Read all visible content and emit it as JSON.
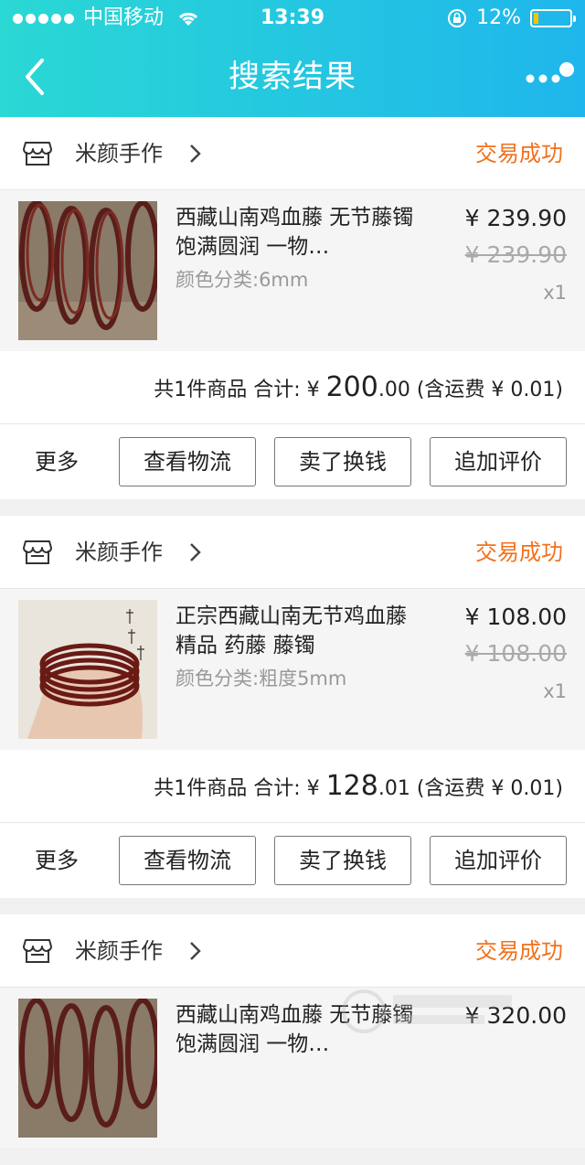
{
  "status_bar": {
    "carrier": "中国移动",
    "time": "13:39",
    "battery": "12%"
  },
  "nav": {
    "title": "搜索结果"
  },
  "orders": [
    {
      "shop": "米颜手作",
      "status": "交易成功",
      "item": {
        "title": "西藏山南鸡血藤 无节藤镯 饱满圆润 一物…",
        "spec": "颜色分类:6mm",
        "price": "¥ 239.90",
        "original_price": "¥ 239.90",
        "quantity": "x1"
      },
      "summary": {
        "prefix": "共1件商品 合计: ¥ ",
        "amount_int": "200",
        "amount_dec": ".00",
        "shipping": " (含运费 ¥ 0.01)"
      },
      "actions": {
        "more": "更多",
        "b1": "查看物流",
        "b2": "卖了换钱",
        "b3": "追加评价"
      }
    },
    {
      "shop": "米颜手作",
      "status": "交易成功",
      "item": {
        "title": "正宗西藏山南无节鸡血藤 精品 药藤 藤镯",
        "spec": "颜色分类:粗度5mm",
        "price": "¥ 108.00",
        "original_price": "¥ 108.00",
        "quantity": "x1"
      },
      "summary": {
        "prefix": "共1件商品 合计: ¥ ",
        "amount_int": "128",
        "amount_dec": ".01",
        "shipping": " (含运费 ¥ 0.01)"
      },
      "actions": {
        "more": "更多",
        "b1": "查看物流",
        "b2": "卖了换钱",
        "b3": "追加评价"
      }
    },
    {
      "shop": "米颜手作",
      "status": "交易成功",
      "item": {
        "title": "西藏山南鸡血藤 无节藤镯 饱满圆润 一物…",
        "price": "¥ 320.00"
      }
    }
  ],
  "colors": {
    "header_start": "#2ad8d4",
    "header_end": "#1fb6ec",
    "status_accent": "#f2711c"
  },
  "icons": [
    "signal-dots-icon",
    "wifi-icon",
    "lock-rotation-icon",
    "battery-icon",
    "back-icon",
    "more-dots-icon",
    "store-icon",
    "chevron-right-icon"
  ]
}
